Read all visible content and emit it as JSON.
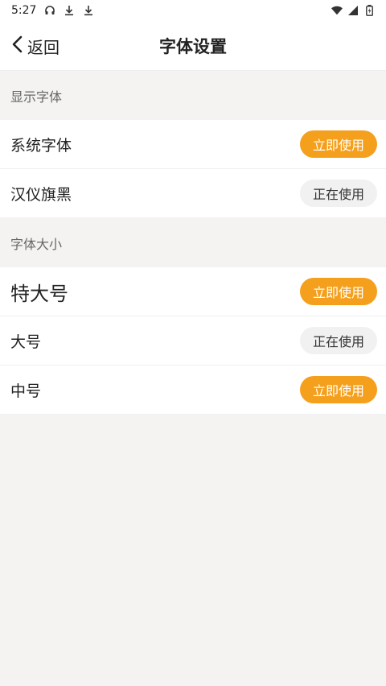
{
  "status_bar": {
    "time": "5:27",
    "left_icons": [
      "headset-icon",
      "download-icon",
      "download-icon"
    ],
    "right_icons": [
      "wifi-icon",
      "signal-icon",
      "battery-icon"
    ]
  },
  "nav": {
    "back_label": "返回",
    "title": "字体设置"
  },
  "sections": [
    {
      "header": "显示字体",
      "items": [
        {
          "label": "系统字体",
          "action": "立即使用",
          "state": "use"
        },
        {
          "label": "汉仪旗黑",
          "action": "正在使用",
          "state": "active"
        }
      ]
    },
    {
      "header": "字体大小",
      "items": [
        {
          "label": "特大号",
          "action": "立即使用",
          "state": "use"
        },
        {
          "label": "大号",
          "action": "正在使用",
          "state": "active"
        },
        {
          "label": "中号",
          "action": "立即使用",
          "state": "use"
        }
      ]
    }
  ],
  "colors": {
    "accent": "#f5a01d",
    "active_pill_bg": "#f1f1f1",
    "page_bg": "#f4f3f2"
  }
}
